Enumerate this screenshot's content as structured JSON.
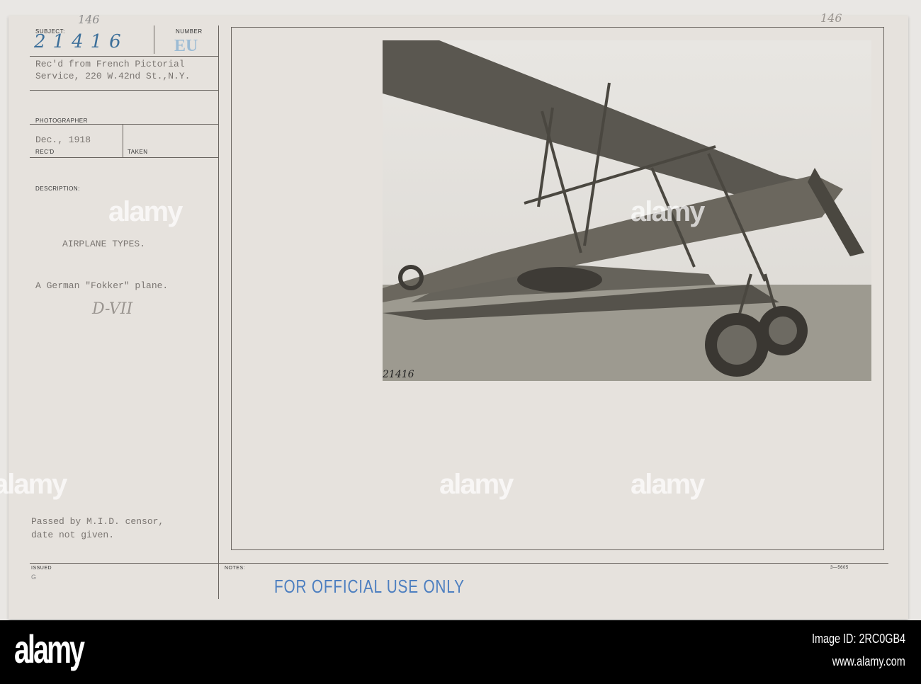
{
  "card": {
    "subject_label": "SUBJECT:",
    "subject_number": "21416",
    "subject_note": "146",
    "number_label": "NUMBER",
    "number_value": "EU",
    "corner_note": "146",
    "received_from": "Rec'd from French Pictorial",
    "received_from_2": "Service, 220 W.42nd St.,N.Y.",
    "photographer_label": "PHOTOGRAPHER",
    "date": "Dec., 1918",
    "recd_label": "REC'D",
    "taken_label": "TAKEN",
    "description_label": "DESCRIPTION:",
    "description_title": "AIRPLANE TYPES.",
    "description_text": "A German \"Fokker\" plane.",
    "handwritten_model": "D-VII",
    "censor_line1": "Passed by M.I.D. censor,",
    "censor_line2": "date not given.",
    "issued_label": "ISSUED",
    "issued_value": "G",
    "notes_label": "NOTES:",
    "form_number": "3—5605",
    "stamp": "FOR OFFICIAL USE ONLY",
    "photo_number": "21416"
  },
  "watermark": "alamy",
  "footer": {
    "logo": "alamy",
    "image_id": "Image ID: 2RC0GB4",
    "url": "www.alamy.com"
  }
}
